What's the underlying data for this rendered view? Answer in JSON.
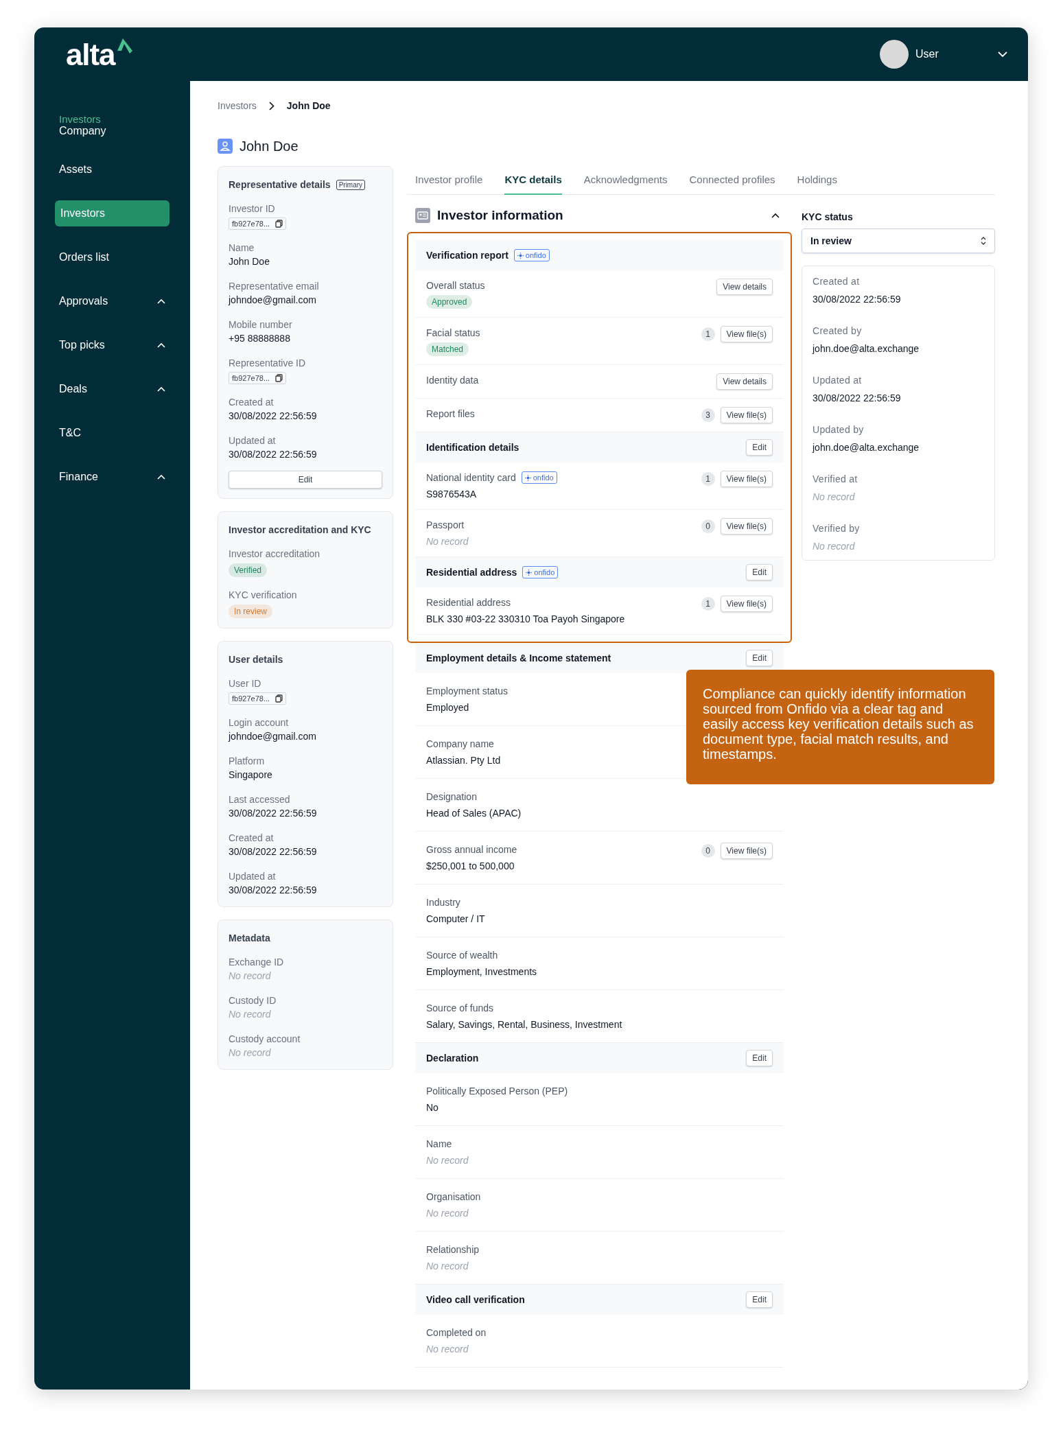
{
  "logo": {
    "text": "alta"
  },
  "user": {
    "name": "User"
  },
  "sidebar": {
    "items": [
      {
        "label": "Company",
        "ghost_label": "Investors",
        "selected": false,
        "expandable": false
      },
      {
        "label": "Assets",
        "selected": false,
        "expandable": false
      },
      {
        "label": "Investors",
        "selected": true,
        "expandable": false
      },
      {
        "label": "Orders list",
        "selected": false,
        "expandable": false
      },
      {
        "label": "Approvals",
        "selected": false,
        "expandable": true
      },
      {
        "label": "Top picks",
        "selected": false,
        "expandable": true
      },
      {
        "label": "Deals",
        "selected": false,
        "expandable": true
      },
      {
        "label": "T&C",
        "selected": false,
        "expandable": false
      },
      {
        "label": "Finance",
        "selected": false,
        "expandable": true
      }
    ]
  },
  "breadcrumb": [
    "Investors",
    "John Doe"
  ],
  "page_title": "John Doe",
  "left_cards": [
    {
      "title": "Representative details",
      "badge": "Primary",
      "button": "Edit",
      "fields": [
        {
          "label": "Investor ID",
          "value": "fb927e78...",
          "kind": "id"
        },
        {
          "label": "Name",
          "value": "John Doe",
          "kind": "text"
        },
        {
          "label": "Representative email",
          "value": "johndoe@gmail.com",
          "kind": "text"
        },
        {
          "label": "Mobile number",
          "value": "+95 88888888",
          "kind": "text"
        },
        {
          "label": "Representative ID",
          "value": "fb927e78...",
          "kind": "id"
        },
        {
          "label": "Created at",
          "value": "30/08/2022 22:56:59",
          "kind": "text"
        },
        {
          "label": "Updated at",
          "value": "30/08/2022 22:56:59",
          "kind": "text"
        }
      ]
    },
    {
      "title": "Investor accreditation and KYC",
      "fields": [
        {
          "label": "Investor accreditation",
          "value": "Verified",
          "kind": "tag",
          "color": "#1f8a5c"
        },
        {
          "label": "KYC verification",
          "value": "In review",
          "kind": "tag",
          "color": "#d97a2c"
        }
      ]
    },
    {
      "title": "User details",
      "fields": [
        {
          "label": "User ID",
          "value": "fb927e78...",
          "kind": "id"
        },
        {
          "label": "Login account",
          "value": "johndoe@gmail.com",
          "kind": "text"
        },
        {
          "label": "Platform",
          "value": "Singapore",
          "kind": "text"
        },
        {
          "label": "Last accessed",
          "value": "30/08/2022 22:56:59",
          "kind": "text"
        },
        {
          "label": "Created at",
          "value": "30/08/2022 22:56:59",
          "kind": "text"
        },
        {
          "label": "Updated at",
          "value": "30/08/2022 22:56:59",
          "kind": "text"
        }
      ]
    },
    {
      "title": "Metadata",
      "fields": [
        {
          "label": "Exchange ID",
          "value": "No record",
          "kind": "empty"
        },
        {
          "label": "Custody ID",
          "value": "No record",
          "kind": "empty"
        },
        {
          "label": "Custody account",
          "value": "No record",
          "kind": "empty"
        }
      ]
    }
  ],
  "tabs": [
    {
      "label": "Investor profile",
      "selected": false
    },
    {
      "label": "KYC details",
      "selected": true
    },
    {
      "label": "Acknowledgments",
      "selected": false
    },
    {
      "label": "Connected profiles",
      "selected": false
    },
    {
      "label": "Holdings",
      "selected": false
    }
  ],
  "section": {
    "title": "Investor information",
    "expanded": true,
    "groups": [
      {
        "title": "Verification report",
        "source": "onfido",
        "highlighted": true,
        "rows": [
          {
            "label": "Overall status",
            "value": "Approved",
            "kind": "tag",
            "color": "#1f8a5c",
            "button": "View details"
          },
          {
            "label": "Facial status",
            "value": "Matched",
            "kind": "tag",
            "color": "#1f8a5c",
            "count": "1",
            "button": "View file(s)"
          },
          {
            "label": "Identity data",
            "button": "View details"
          },
          {
            "label": "Report files",
            "count": "3",
            "button": "View file(s)"
          }
        ]
      },
      {
        "title": "Identification details",
        "action": "Edit",
        "highlighted": true,
        "rows": [
          {
            "label": "National identity card",
            "source": "onfido",
            "value": "S9876543A",
            "kind": "text",
            "count": "1",
            "button": "View file(s)"
          },
          {
            "label": "Passport",
            "value": "No record",
            "kind": "empty",
            "count": "0",
            "button": "View file(s)"
          }
        ]
      },
      {
        "title": "Residential address",
        "source": "onfido",
        "action": "Edit",
        "highlighted": true,
        "rows": [
          {
            "label": "Residential address",
            "value": "BLK 330 #03-22 330310 Toa Payoh Singapore",
            "kind": "text",
            "count": "1",
            "button": "View file(s)"
          }
        ]
      },
      {
        "title": "Employment details & Income statement",
        "action": "Edit",
        "highlighted": false,
        "rows": [
          {
            "label": "Employment status",
            "value": "Employed",
            "kind": "text"
          },
          {
            "label": "Company name",
            "value": "Atlassian. Pty Ltd",
            "kind": "text"
          },
          {
            "label": "Designation",
            "value": "Head of Sales (APAC)",
            "kind": "text"
          },
          {
            "label": "Gross annual income",
            "value": "$250,001 to 500,000",
            "kind": "text",
            "count": "0",
            "button": "View file(s)"
          },
          {
            "label": "Industry",
            "value": "Computer / IT",
            "kind": "text"
          },
          {
            "label": "Source of wealth",
            "value": "Employment, Investments",
            "kind": "text"
          },
          {
            "label": "Source of funds",
            "value": "Salary, Savings, Rental, Business, Investment",
            "kind": "text"
          }
        ]
      },
      {
        "title": "Declaration",
        "action": "Edit",
        "highlighted": false,
        "rows": [
          {
            "label": "Politically Exposed Person (PEP)",
            "value": "No",
            "kind": "text"
          },
          {
            "label": "Name",
            "value": "No record",
            "kind": "empty"
          },
          {
            "label": "Organisation",
            "value": "No record",
            "kind": "empty"
          },
          {
            "label": "Relationship",
            "value": "No record",
            "kind": "empty"
          }
        ]
      },
      {
        "title": "Video call verification",
        "action": "Edit",
        "highlighted": false,
        "rows": [
          {
            "label": "Completed on",
            "value": "No record",
            "kind": "empty"
          }
        ]
      }
    ]
  },
  "kyc_status": {
    "label": "KYC status",
    "value": "In review"
  },
  "audit": [
    {
      "label": "Created at",
      "value": "30/08/2022 22:56:59",
      "kind": "text"
    },
    {
      "label": "Created by",
      "value": "john.doe@alta.exchange",
      "kind": "text"
    },
    {
      "label": "Updated at",
      "value": "30/08/2022 22:56:59",
      "kind": "text"
    },
    {
      "label": "Updated by",
      "value": "john.doe@alta.exchange",
      "kind": "text"
    },
    {
      "label": "Verified at",
      "value": "No record",
      "kind": "empty"
    },
    {
      "label": "Verified by",
      "value": "No record",
      "kind": "empty"
    }
  ],
  "callout": {
    "text": "Compliance can quickly identify information sourced from Onfido via a clear tag and easily access key verification details such as document type, facial match results, and timestamps."
  }
}
